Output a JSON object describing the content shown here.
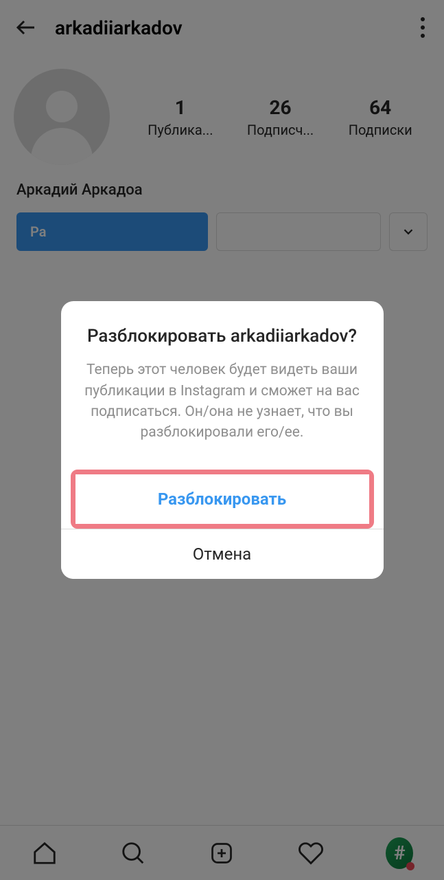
{
  "header": {
    "username": "arkadiiarkadov"
  },
  "profile": {
    "displayName": "Аркадий Аркадоа",
    "stats": {
      "posts": {
        "count": "1",
        "label": "Публика..."
      },
      "followers": {
        "count": "26",
        "label": "Подписч..."
      },
      "following": {
        "count": "64",
        "label": "Подписки"
      }
    }
  },
  "actions": {
    "primaryLabel": "Ра"
  },
  "dialog": {
    "title": "Разблокировать arkadiiarkadov?",
    "body": "Теперь этот человек будет видеть ваши публикации в Instagram и сможет на вас подписаться. Он/она не узнает, что вы разблокировали его/ее.",
    "confirmLabel": "Разблокировать",
    "cancelLabel": "Отмена"
  }
}
